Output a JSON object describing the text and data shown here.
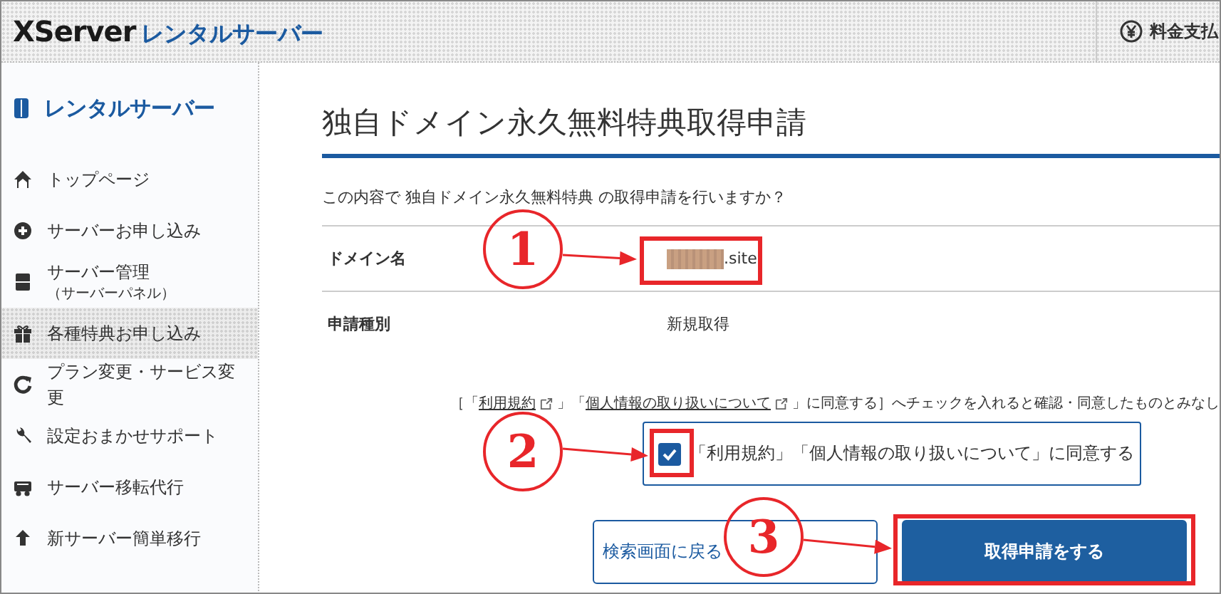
{
  "header": {
    "brand": "XServer",
    "product": "レンタルサーバー",
    "billing_label": "料金支払"
  },
  "sidebar": {
    "title": "レンタルサーバー",
    "items": [
      {
        "kind": "home",
        "label": "トップページ",
        "selected": false
      },
      {
        "kind": "plus",
        "label": "サーバーお申し込み",
        "selected": false
      },
      {
        "kind": "server",
        "label": "サーバー管理",
        "sublabel": "（サーバーパネル）",
        "selected": false
      },
      {
        "kind": "gift",
        "label": "各種特典お申し込み",
        "selected": true
      },
      {
        "kind": "refresh",
        "label": "プラン変更・サービス変更",
        "selected": false
      },
      {
        "kind": "wrench",
        "label": "設定おまかせサポート",
        "selected": false
      },
      {
        "kind": "truck",
        "label": "サーバー移転代行",
        "selected": false
      },
      {
        "kind": "upload",
        "label": "新サーバー簡単移行",
        "selected": false
      }
    ]
  },
  "main": {
    "title": "独自ドメイン永久無料特典取得申請",
    "question": "この内容で 独自ドメイン永久無料特典 の取得申請を行いますか？",
    "rows": [
      {
        "label": "ドメイン名",
        "value": ".site",
        "redacted": true
      },
      {
        "label": "申請種別",
        "value": "新規取得",
        "redacted": false
      }
    ],
    "notice": [
      {
        "kind": "text",
        "text": "［「"
      },
      {
        "kind": "link",
        "text": "利用規約"
      },
      {
        "kind": "text",
        "text": "」「"
      },
      {
        "kind": "link",
        "text": "個人情報の取り扱いについて"
      },
      {
        "kind": "text",
        "text": "」に同意する］へチェックを入れると確認・同意したものとみなし"
      }
    ],
    "agreement": {
      "label": "「利用規約」「個人情報の取り扱いについて」に同意する",
      "checked": true
    },
    "buttons": [
      {
        "kind": "secondary",
        "label": "検索画面に戻る"
      },
      {
        "kind": "primary",
        "label": "取得申請をする"
      }
    ]
  },
  "annotations": [
    {
      "label": "1"
    },
    {
      "label": "2"
    },
    {
      "label": "3"
    }
  ]
}
